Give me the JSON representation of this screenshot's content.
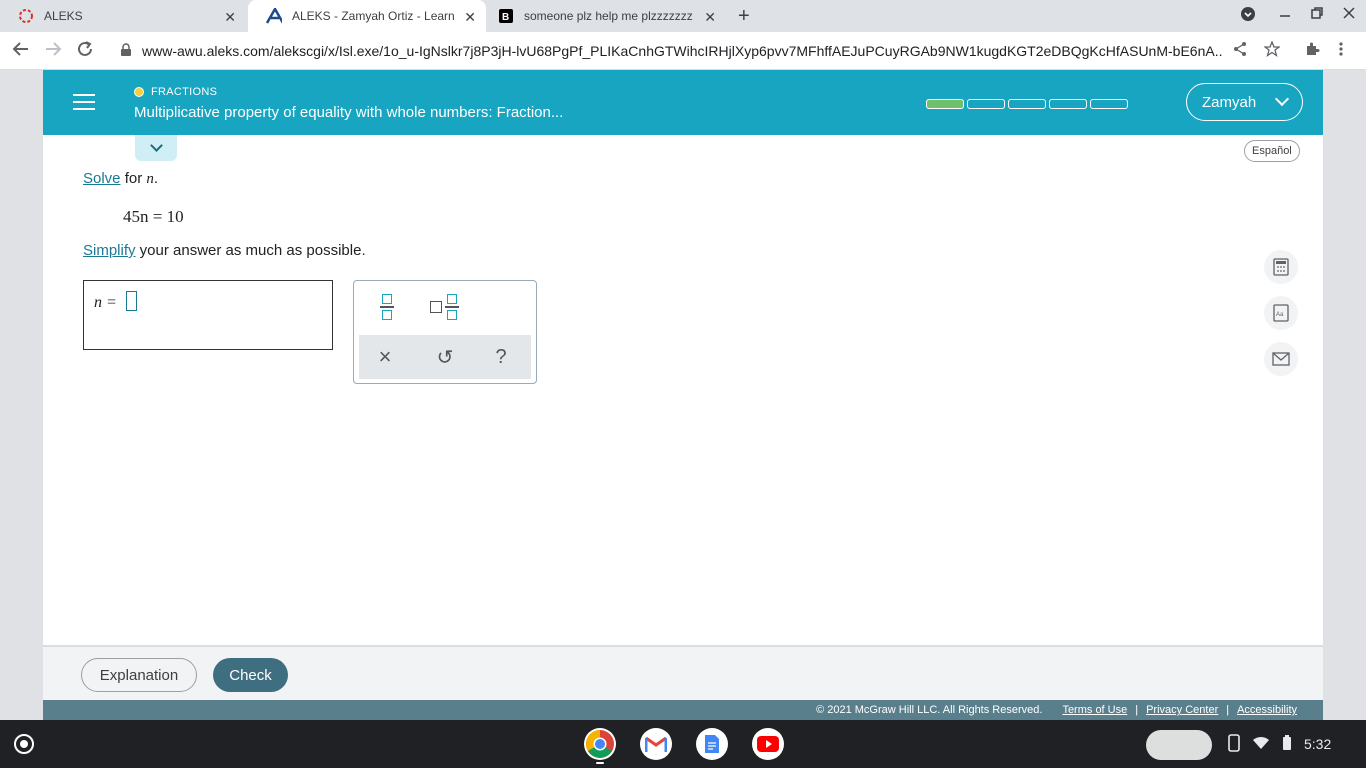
{
  "browser": {
    "tabs": [
      {
        "title": "ALEKS",
        "close": "✕"
      },
      {
        "title": "ALEKS - Zamyah Ortiz - Learn",
        "close": "✕"
      },
      {
        "title": "someone plz help me plzzzzzzz",
        "close": "✕"
      }
    ],
    "new_tab": "+",
    "url": "www-awu.aleks.com/alekscgi/x/Isl.exe/1o_u-IgNslkr7j8P3jH-lvU68PgPf_PLIKaCnhGTWihcIRHjlXyp6pvv7MFhffAEJuPCuyRGAb9NW1kugdKGT2eDBQgKcHfASUnM-bE6nA..."
  },
  "header": {
    "topic": "FRACTIONS",
    "title": "Multiplicative property of equality with whole numbers: Fraction...",
    "progress_total": 5,
    "progress_done": 1,
    "user_name": "Zamyah"
  },
  "espanol": "Español",
  "question": {
    "solve_link": "Solve",
    "for_text": " for ",
    "variable": "n",
    "period": ".",
    "equation": "45n = 10",
    "simplify_link": "Simplify",
    "simplify_rest": " your answer as much as possible."
  },
  "answer": {
    "label": "n =",
    "value": ""
  },
  "keypad": {
    "clear": "×",
    "undo": "↺",
    "help": "?"
  },
  "footer": {
    "explanation": "Explanation",
    "check": "Check",
    "copyright": "© 2021 McGraw Hill LLC. All Rights Reserved.",
    "terms": "Terms of Use",
    "privacy": "Privacy Center",
    "accessibility": "Accessibility",
    "sep": "|"
  },
  "shelf": {
    "time": "5:32"
  },
  "colors": {
    "header": "#17a5c1",
    "progress_done": "#6fc06d",
    "check_button": "#3f6e80"
  }
}
